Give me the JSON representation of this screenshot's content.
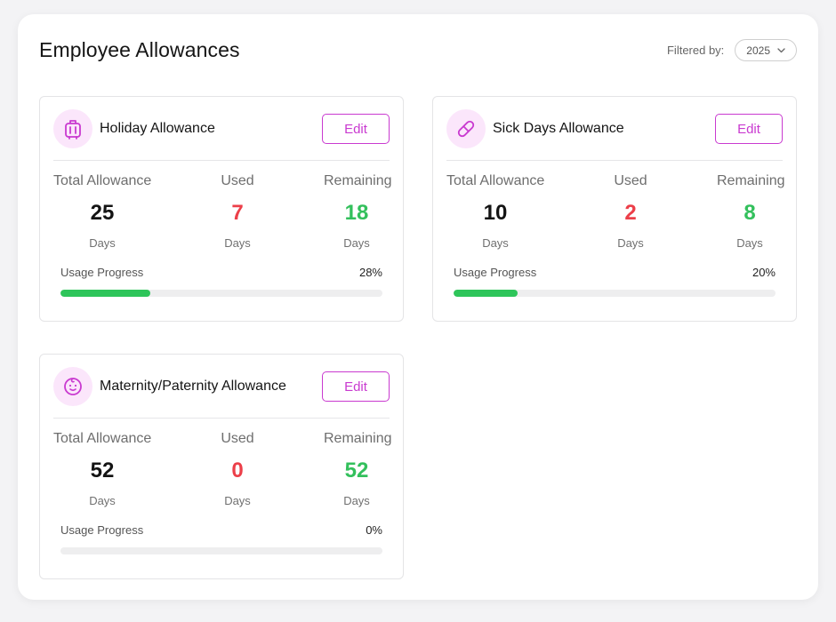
{
  "page": {
    "title": "Employee Allowances",
    "filter_label": "Filtered by:",
    "filter_value": "2025"
  },
  "labels": {
    "total": "Total Allowance",
    "used": "Used",
    "remaining": "Remaining",
    "unit": "Days",
    "progress": "Usage Progress",
    "edit": "Edit"
  },
  "colors": {
    "accent": "#c93ad0",
    "icon_bg": "#fbe6fb",
    "used": "#ec3f49",
    "remaining": "#33c05c",
    "progress_fill": "#2ec55a"
  },
  "cards": [
    {
      "title": "Holiday Allowance",
      "icon": "suitcase-icon",
      "total": "25",
      "used": "7",
      "remaining": "18",
      "progress_text": "28%",
      "progress": 0.28
    },
    {
      "title": "Sick Days Allowance",
      "icon": "pill-icon",
      "total": "10",
      "used": "2",
      "remaining": "8",
      "progress_text": "20%",
      "progress": 0.2
    },
    {
      "title": "Maternity/Paternity Allowance",
      "icon": "baby-face-icon",
      "total": "52",
      "used": "0",
      "remaining": "52",
      "progress_text": "0%",
      "progress": 0
    }
  ]
}
